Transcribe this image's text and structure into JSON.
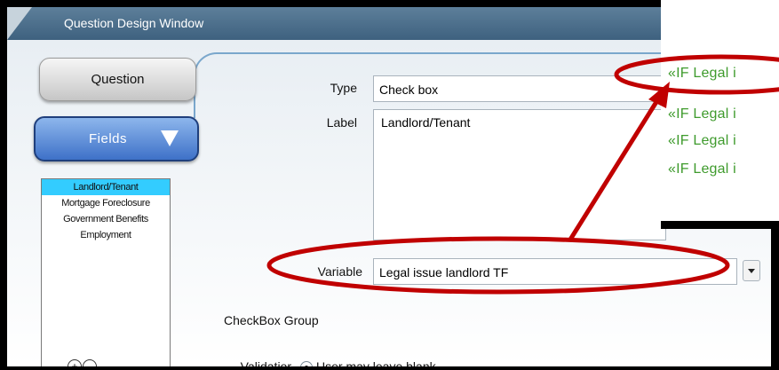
{
  "window": {
    "title": "Question Design Window"
  },
  "tabs": {
    "question_label": "Question",
    "fields_label": "Fields"
  },
  "fields": {
    "items": [
      {
        "label": "Landlord/Tenant",
        "selected": true
      },
      {
        "label": "Mortgage Foreclosure",
        "selected": false
      },
      {
        "label": "Government Benefits",
        "selected": false
      },
      {
        "label": "Employment",
        "selected": false
      }
    ],
    "add_glyph": "+",
    "remove_glyph": "-"
  },
  "form": {
    "type_label": "Type",
    "type_value": "Check box",
    "label_label": "Label",
    "label_value": "Landlord/Tenant",
    "variable_label": "Variable",
    "variable_value": "Legal issue landlord TF",
    "checkbox_group_label": "CheckBox Group",
    "validation_label": "Validatior",
    "validation_option": "User may leave blank"
  },
  "document_snippet": {
    "lines": [
      "«IF Legal i",
      "«IF Legal i",
      "«IF Legal i",
      "«IF Legal i"
    ],
    "text_color": "#3f9b2d"
  },
  "annotation": {
    "color": "#c00000"
  },
  "icons": {
    "fields_dropdown": "triangle-down-icon",
    "variable_dropdown": "chevron-down-icon"
  }
}
